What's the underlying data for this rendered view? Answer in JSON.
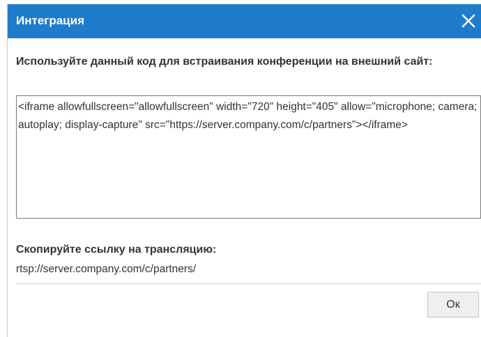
{
  "dialog": {
    "title": "Интеграция",
    "close_icon": "close-icon",
    "embed_label": "Используйте данный код для встраивания конференции на внешний сайт:",
    "embed_code": "<iframe allowfullscreen=\"allowfullscreen\" width=\"720\" height=\"405\" allow=\"microphone; camera; autoplay; display-capture\" src=\"https://server.company.com/c/partners\"></iframe>",
    "stream_label": "Скопируйте ссылку на трансляцию:",
    "stream_link": "rtsp://server.company.com/c/partners/",
    "ok_label": "Ок"
  },
  "colors": {
    "titlebar": "#1f7ccb",
    "title_text": "#ffffff",
    "body_text": "#333333"
  }
}
